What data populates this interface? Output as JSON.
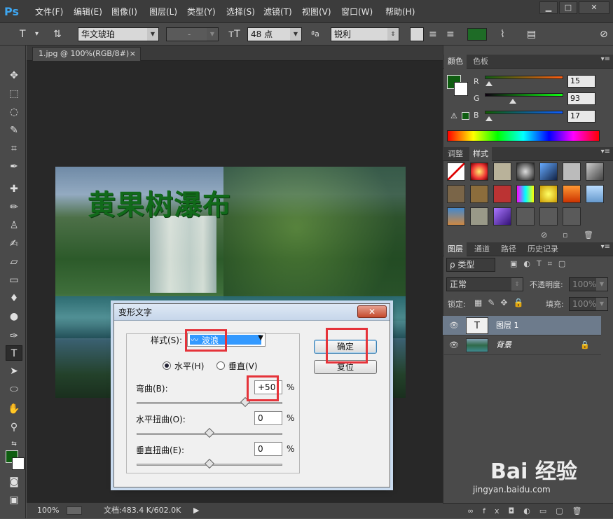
{
  "menubar": {
    "logo": "Ps",
    "items": [
      "文件(F)",
      "编辑(E)",
      "图像(I)",
      "图层(L)",
      "类型(Y)",
      "选择(S)",
      "滤镜(T)",
      "视图(V)",
      "窗口(W)",
      "帮助(H)"
    ],
    "win_buttons": [
      "▁",
      "□",
      "✕"
    ]
  },
  "options": {
    "font_family": "华文琥珀",
    "font_style": "-",
    "font_size": "48 点",
    "aa_icon": "ªa",
    "antialias": "锐利",
    "text_color": "#1e6b26"
  },
  "doc": {
    "tab_title": "1.jpg @ 100%(RGB/8#)",
    "canvas_text": "黄果树瀑布",
    "zoom": "100%",
    "doc_info": "文档:483.4 K/602.0K"
  },
  "color_panel": {
    "tabs": [
      "颜色",
      "色板"
    ],
    "r_label": "R",
    "g_label": "G",
    "b_label": "B",
    "r": "15",
    "g": "93",
    "b": "17",
    "fg_color": "#0f5d11"
  },
  "styles_panel": {
    "tabs": [
      "调整",
      "样式"
    ]
  },
  "layers_panel": {
    "tabs": [
      "图层",
      "通道",
      "路径",
      "历史记录"
    ],
    "filter_label": "ρ 类型",
    "blend_mode": "正常",
    "opacity_label": "不透明度:",
    "opacity": "100%",
    "lock_label": "锁定:",
    "fill_label": "填充:",
    "fill": "100%",
    "layers": [
      {
        "name": "图层 1",
        "type": "text"
      },
      {
        "name": "背景",
        "type": "image"
      }
    ]
  },
  "dialog": {
    "title": "变形文字",
    "close": "✕",
    "style_label": "样式(S):",
    "style_value": "波浪",
    "horizontal": "水平(H)",
    "vertical": "垂直(V)",
    "bend_label": "弯曲(B):",
    "bend_value": "+50",
    "hdistort_label": "水平扭曲(O):",
    "hdistort_value": "0",
    "vdistort_label": "垂直扭曲(E):",
    "vdistort_value": "0",
    "percent": "%",
    "ok": "确定",
    "reset": "复位"
  },
  "watermark": {
    "brand": "Bai 经验",
    "url": "jingyan.baidu.com"
  }
}
